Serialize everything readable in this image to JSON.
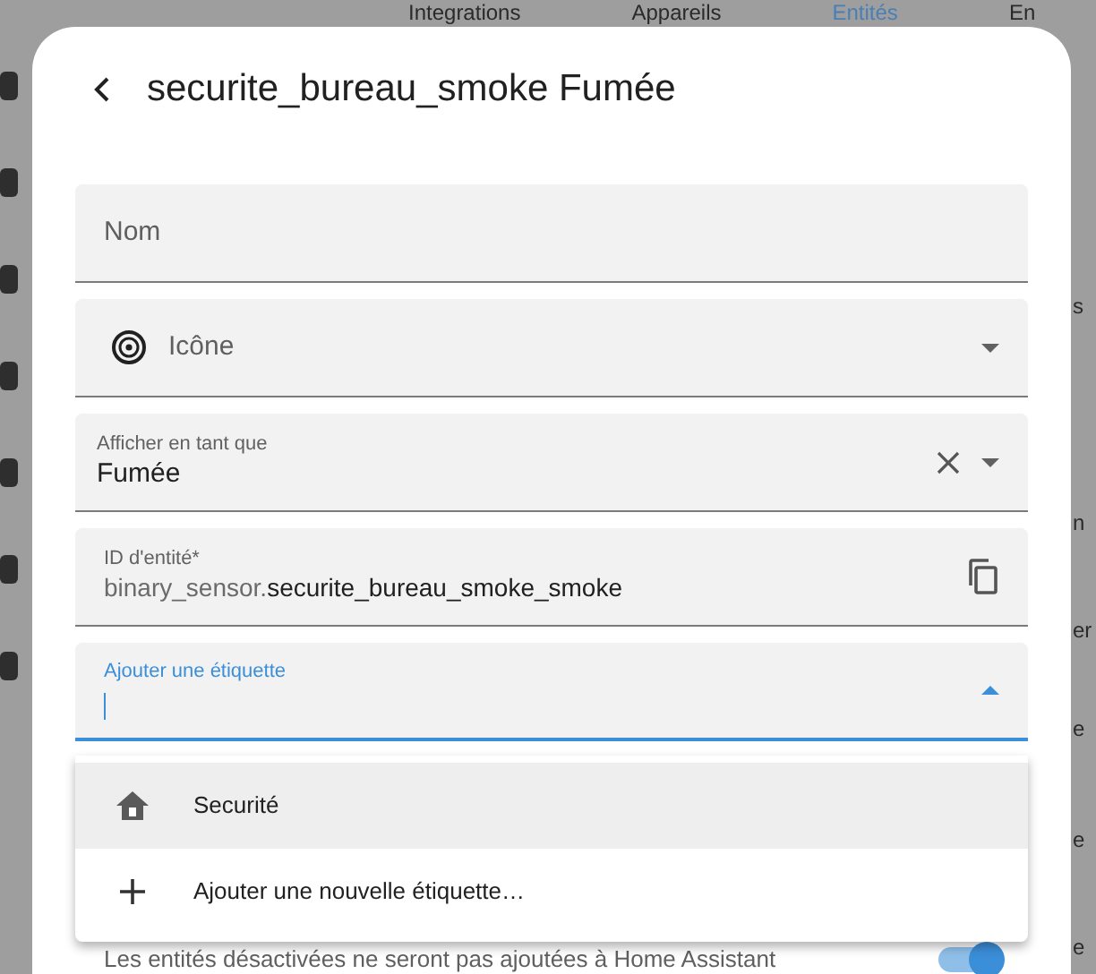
{
  "background": {
    "tabs": [
      {
        "label": "Integrations",
        "selected": false
      },
      {
        "label": "Appareils",
        "selected": false
      },
      {
        "label": "Entités",
        "selected": true
      },
      {
        "label": "En",
        "selected": false
      }
    ],
    "row_fragments": [
      "s",
      "n",
      "er",
      "e",
      "e",
      "e"
    ]
  },
  "dialog": {
    "title": "securite_bureau_smoke Fumée",
    "fields": [
      {
        "kind": "text",
        "label": "Nom"
      },
      {
        "kind": "icon",
        "label": "Icône"
      },
      {
        "kind": "select",
        "label": "Afficher en tant que",
        "value": "Fumée"
      },
      {
        "kind": "entity_id",
        "label": "ID d'entité*",
        "prefix": "binary_sensor.",
        "value": "securite_bureau_smoke_smoke"
      },
      {
        "kind": "combo",
        "label": "Ajouter une étiquette",
        "focused": true
      }
    ],
    "menu": [
      {
        "kind": "label",
        "label": "Securité",
        "highlighted": true
      },
      {
        "kind": "add",
        "label": "Ajouter une nouvelle étiquette…",
        "highlighted": false
      }
    ],
    "enabled": {
      "description": "Les entités désactivées ne seront pas ajoutées à Home Assistant",
      "on": true
    }
  }
}
